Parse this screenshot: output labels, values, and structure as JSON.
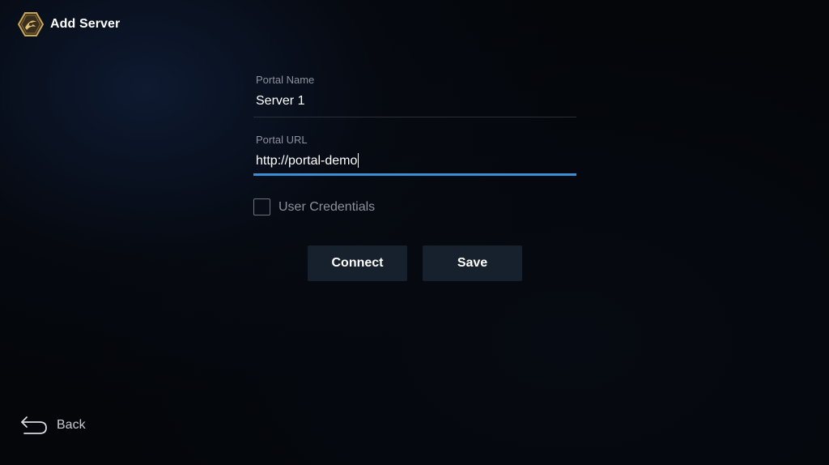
{
  "header": {
    "title": "Add Server",
    "logo_icon": "hexagon-logo-icon"
  },
  "form": {
    "portal_name": {
      "label": "Portal Name",
      "value": "Server 1"
    },
    "portal_url": {
      "label": "Portal URL",
      "value": "http://portal-demo",
      "focused": true
    },
    "user_credentials": {
      "label": "User Credentials",
      "checked": false
    }
  },
  "buttons": {
    "connect_label": "Connect",
    "save_label": "Save"
  },
  "footer": {
    "back_label": "Back",
    "back_icon": "back-arrow-icon"
  },
  "colors": {
    "accent": "#3a8fd6",
    "button_bg": "#16212d",
    "label_gray": "#8b929c",
    "logo_gold": "#c9a55a"
  }
}
